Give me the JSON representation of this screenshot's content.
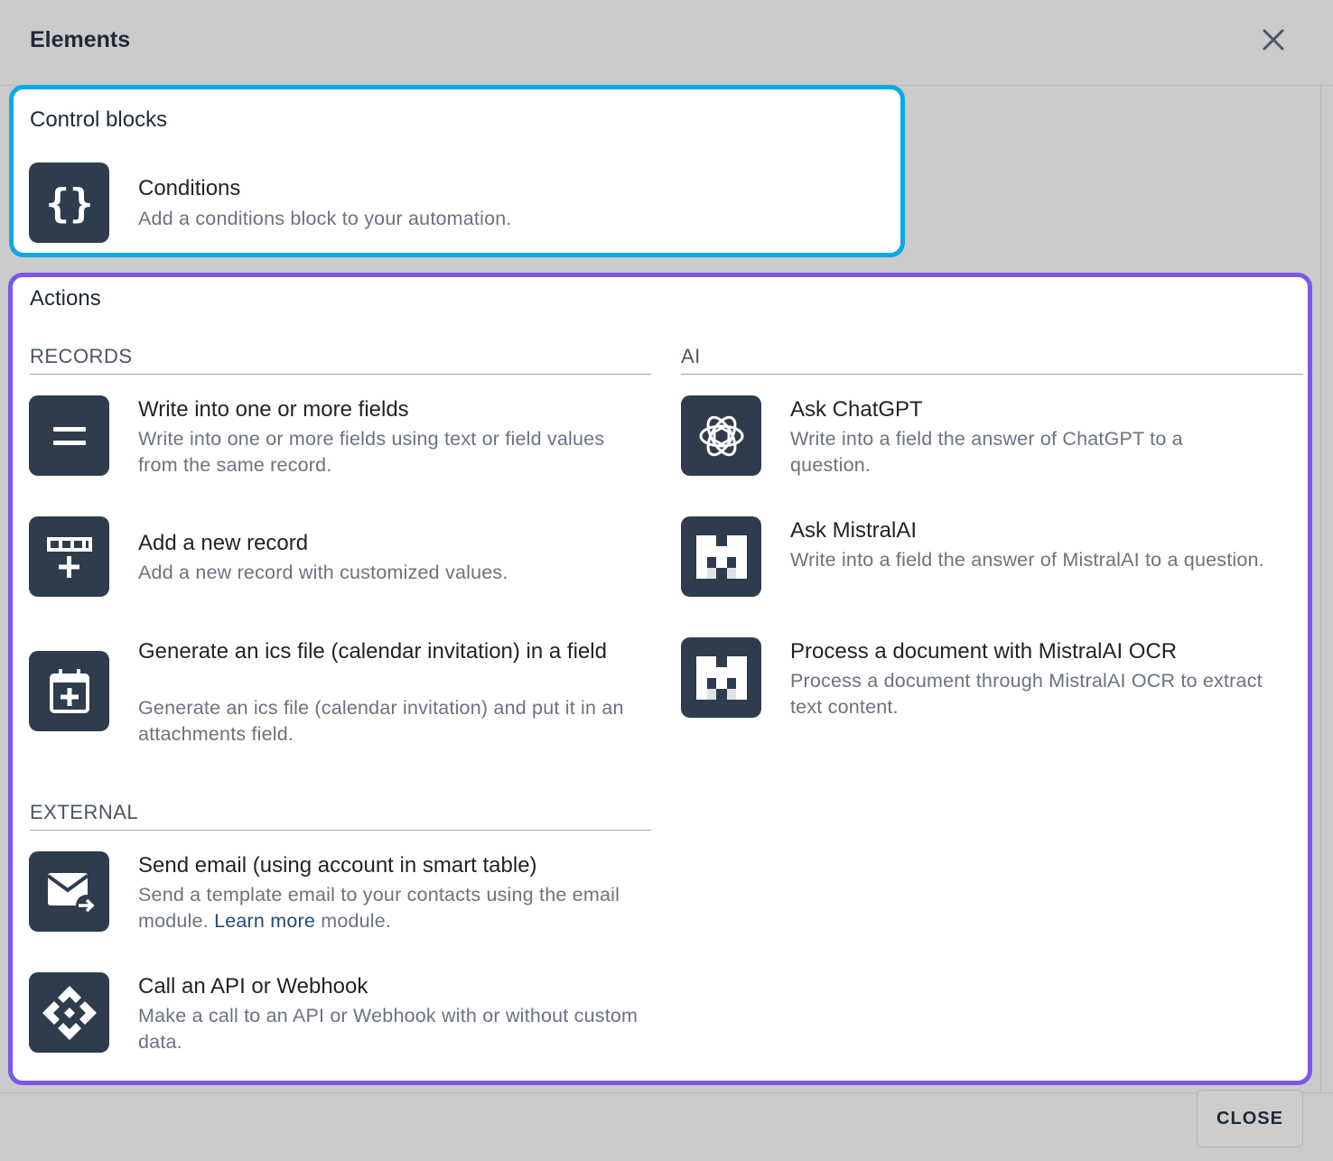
{
  "modal": {
    "title": "Elements",
    "close_button_label": "CLOSE"
  },
  "control_blocks": {
    "title": "Control blocks",
    "items": [
      {
        "icon": "braces-icon",
        "title": "Conditions",
        "description": "Add a conditions block to your automation."
      }
    ]
  },
  "actions": {
    "title": "Actions",
    "records": {
      "heading": "RECORDS",
      "items": [
        {
          "icon": "equals-icon",
          "title": "Write into one or more fields",
          "description": "Write into one or more fields using text or field values from the same record."
        },
        {
          "icon": "table-add-row-icon",
          "title": "Add a new record",
          "description": "Add a new record with customized values."
        },
        {
          "icon": "calendar-plus-icon",
          "title": "Generate an ics file (calendar invitation) in a field",
          "description": "Generate an ics file (calendar invitation) and put it in an attachments field."
        }
      ]
    },
    "external": {
      "heading": "EXTERNAL",
      "items": [
        {
          "icon": "email-send-icon",
          "title": "Send email (using account in smart table)",
          "description": "Send a template email to your contacts using the email module.",
          "link_text": "Learn more",
          "description_after_link": "module."
        },
        {
          "icon": "webhook-icon",
          "title": "Call an API or Webhook",
          "description": "Make a call to an API or Webhook with or without custom data."
        }
      ]
    },
    "ai": {
      "heading": "AI",
      "items": [
        {
          "icon": "openai-logo-icon",
          "title": "Ask ChatGPT",
          "description": "Write into a field the answer of ChatGPT to a question."
        },
        {
          "icon": "mistral-logo-icon",
          "title": "Ask MistralAI",
          "description": "Write into a field the answer of MistralAI to a question."
        },
        {
          "icon": "mistral-logo-icon",
          "title": "Process a document with MistralAI OCR",
          "description": "Process a document through MistralAI OCR to extract text content."
        }
      ]
    }
  }
}
